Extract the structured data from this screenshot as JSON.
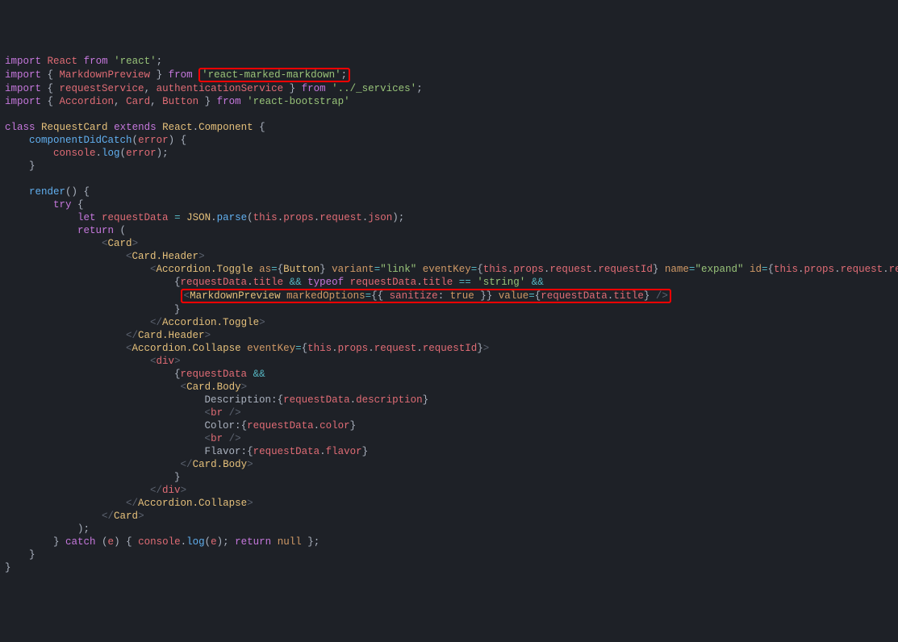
{
  "code": {
    "l1": {
      "import": "import",
      "react": "React",
      "from": "from",
      "reactStr": "'react'"
    },
    "l2": {
      "import": "import",
      "mp": "MarkdownPreview",
      "from": "from",
      "pkg": "'react-marked-markdown'"
    },
    "l3": {
      "import": "import",
      "rs": "requestService",
      "as": "authenticationService",
      "from": "from",
      "svc": "'../_services'"
    },
    "l4": {
      "import": "import",
      "acc": "Accordion",
      "card": "Card",
      "btn": "Button",
      "from": "from",
      "rb": "'react-bootstrap'"
    },
    "l6": {
      "class": "class",
      "rc": "RequestCard",
      "extends": "extends",
      "react": "React",
      "comp": "Component"
    },
    "l7": {
      "cdc": "componentDidCatch",
      "err": "error"
    },
    "l8": {
      "console": "console",
      "log": "log",
      "err": "error"
    },
    "l11": {
      "render": "render"
    },
    "l12": {
      "try": "try"
    },
    "l13": {
      "let": "let",
      "rd": "requestData",
      "json": "JSON",
      "parse": "parse",
      "this": "this",
      "props": "props",
      "request": "request",
      "jsonp": "json"
    },
    "l14": {
      "return": "return"
    },
    "l15": {
      "card": "Card"
    },
    "l16": {
      "ch": "Card.Header"
    },
    "l17": {
      "at": "Accordion.Toggle",
      "as": "as",
      "btn": "Button",
      "variant": "variant",
      "link": "\"link\"",
      "ek": "eventKey",
      "this": "this",
      "props": "props",
      "request": "request",
      "rid": "requestId",
      "name": "name",
      "expand": "\"expand\"",
      "id": "id"
    },
    "l18": {
      "rd": "requestData",
      "title": "title",
      "typeof": "typeof",
      "string": "'string'"
    },
    "l19": {
      "mp": "MarkdownPreview",
      "mo": "markedOptions",
      "san": "sanitize",
      "true": "true",
      "value": "value",
      "rd": "requestData",
      "title": "title"
    },
    "l21": {
      "at": "Accordion.Toggle"
    },
    "l22": {
      "ch": "Card.Header"
    },
    "l23": {
      "ac": "Accordion.Collapse",
      "ek": "eventKey",
      "this": "this",
      "props": "props",
      "request": "request",
      "rid": "requestId"
    },
    "l24": {
      "div": "div"
    },
    "l25": {
      "rd": "requestData"
    },
    "l26": {
      "cb": "Card.Body"
    },
    "l27": {
      "desc": "Description:",
      "rd": "requestData",
      "d": "description"
    },
    "l28": {
      "br": "br"
    },
    "l29": {
      "color": "Color:",
      "rd": "requestData",
      "c": "color"
    },
    "l30": {
      "br": "br"
    },
    "l31": {
      "flavor": "Flavor:",
      "rd": "requestData",
      "f": "flavor"
    },
    "l32": {
      "cb": "Card.Body"
    },
    "l34": {
      "div": "div"
    },
    "l35": {
      "ac": "Accordion.Collapse"
    },
    "l36": {
      "card": "Card"
    },
    "l38": {
      "catch": "catch",
      "e": "e",
      "console": "console",
      "log": "log",
      "return": "return",
      "null": "null"
    }
  }
}
